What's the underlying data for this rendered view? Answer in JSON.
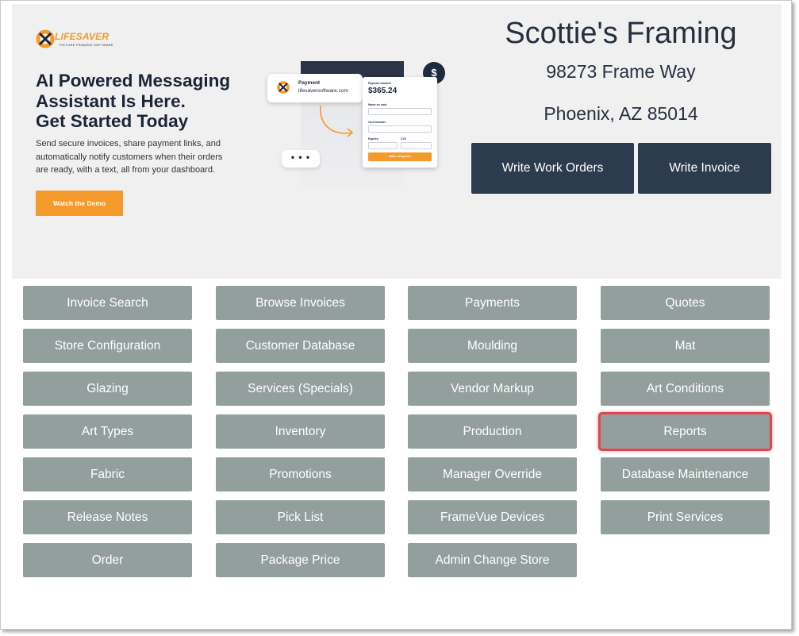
{
  "banner": {
    "logo_text": "LIFESAVER",
    "logo_tagline": "PICTURE FRAMING SOFTWARE",
    "heading_lines": [
      "AI Powered Messaging",
      "Assistant Is Here.",
      "Get Started Today"
    ],
    "body_lines": [
      "Send secure invoices, share payment links, and",
      "automatically notify customers when their orders",
      "are ready, with a text, all from your dashboard."
    ],
    "demo_button": "Watch the Demo",
    "payment_card": {
      "title": "Payment",
      "url": "lifesaversoftware.com"
    },
    "dots": "• • •",
    "dollar_icon": "$",
    "form": {
      "amount_label": "Payment Amount",
      "amount": "$365.24",
      "name_label": "Name on card",
      "card_label": "Card Number",
      "expires_label": "Expires",
      "cvv_label": "CVV",
      "pay_button": "Make a Payment"
    },
    "accent_color": "#f39a2b"
  },
  "store": {
    "name": "Scottie's Framing",
    "address_line1": "98273 Frame Way",
    "address_line2": "Phoenix, AZ 85014"
  },
  "primary_actions": {
    "work_orders": "Write Work Orders",
    "invoice": "Write Invoice"
  },
  "menu": {
    "row1": [
      "Invoice Search",
      "Browse Invoices",
      "Payments",
      "Quotes"
    ],
    "row2": [
      "Store Configuration",
      "Customer Database",
      "Moulding",
      "Mat"
    ],
    "row3": [
      "Glazing",
      "Services (Specials)",
      "Vendor Markup",
      "Art Conditions"
    ],
    "row4": [
      "Art Types",
      "Inventory",
      "Production",
      "Reports"
    ],
    "row5": [
      "Fabric",
      "Promotions",
      "Manager Override",
      "Database Maintenance"
    ],
    "row6": [
      "Release Notes",
      "Pick List",
      "FrameVue Devices",
      "Print Services"
    ],
    "row7": [
      "Order",
      "Package Price",
      "Admin Change Store"
    ]
  },
  "highlighted_item": "Reports",
  "colors": {
    "menu_button": "#939f9d",
    "primary_button": "#2d3b4e",
    "highlight": "#e0474c"
  }
}
